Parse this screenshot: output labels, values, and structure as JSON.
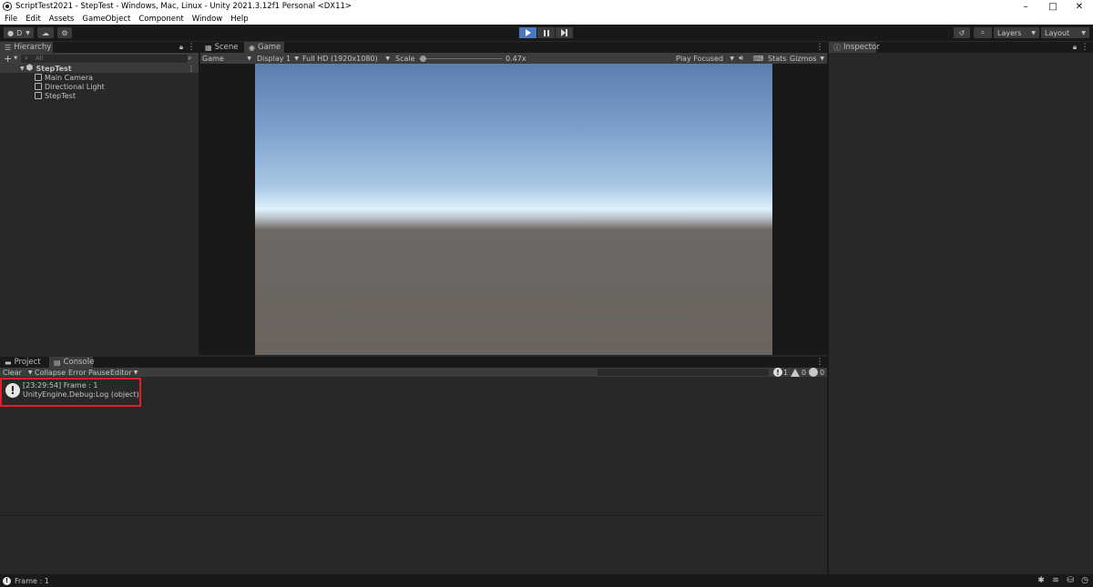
{
  "window": {
    "title": "ScriptTest2021 - StepTest - Windows, Mac, Linux - Unity 2021.3.12f1 Personal <DX11>",
    "controls": [
      "–",
      "□",
      "✕"
    ]
  },
  "menu": [
    "File",
    "Edit",
    "Assets",
    "GameObject",
    "Component",
    "Window",
    "Help"
  ],
  "toolbar": {
    "account_label": "D",
    "layers_label": "Layers",
    "layout_label": "Layout"
  },
  "hierarchy": {
    "tab_label": "Hierarchy",
    "add_label": "+",
    "search_placeholder": "All",
    "scene_name": "StepTest",
    "items": [
      "Main Camera",
      "Directional Light",
      "StepTest"
    ]
  },
  "game": {
    "tabs": [
      "Scene",
      "Game"
    ],
    "mode": "Game",
    "display": "Display 1",
    "resolution": "Full HD (1920x1080)",
    "scale_label": "Scale",
    "scale_value": "0.47x",
    "play_mode": "Play Focused",
    "stats_label": "Stats",
    "gizmos_label": "Gizmos",
    "scale_fraction": 0.05
  },
  "inspector": {
    "tab_label": "Inspector"
  },
  "console": {
    "tabs": [
      "Project",
      "Console"
    ],
    "clear_label": "Clear",
    "collapse_label": "Collapse",
    "error_pause_label": "Error Pause",
    "editor_label": "Editor",
    "info_count": "1",
    "warning_count": "0",
    "error_count": "0",
    "entries": [
      {
        "line1": "[23:29:54] Frame : 1",
        "line2": "UnityEngine.Debug:Log (object)"
      }
    ]
  },
  "statusbar": {
    "message": "Frame : 1"
  },
  "colors": {
    "accent_play": "#4a78c0",
    "highlight_box": "#e0202a",
    "panel_bg": "#282828",
    "toolbar_bg": "#191919"
  }
}
